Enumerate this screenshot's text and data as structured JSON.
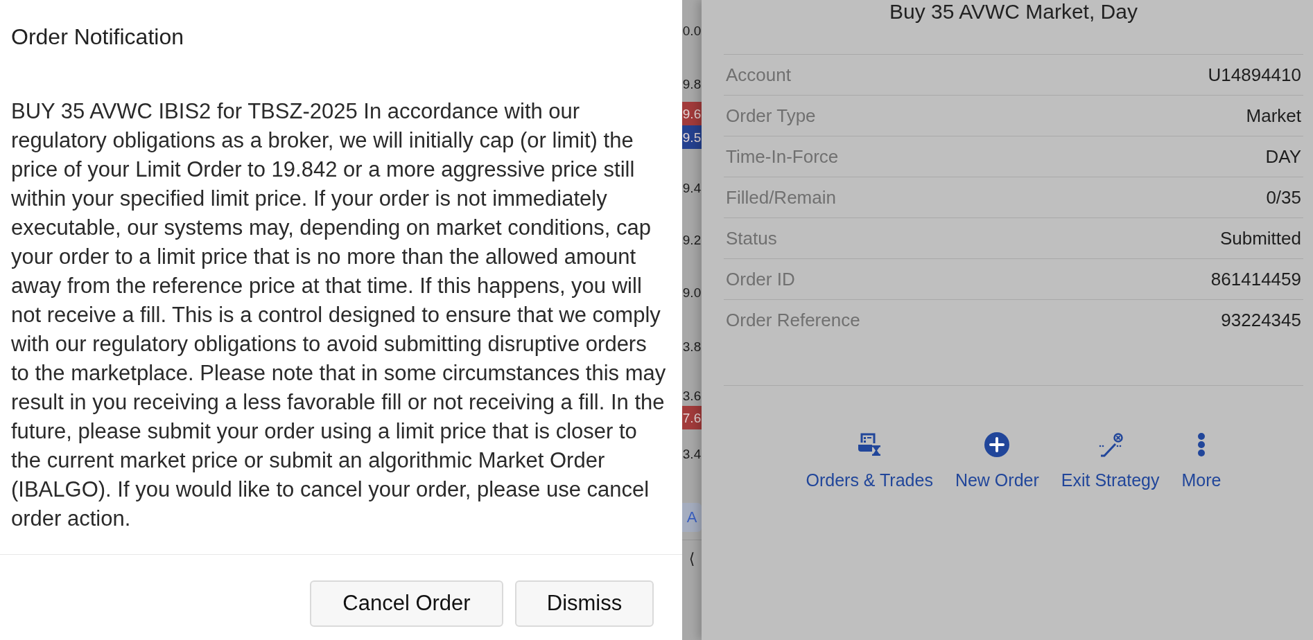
{
  "dialog": {
    "title": "Order Notification",
    "message": "BUY 35 AVWC IBIS2 for TBSZ-2025 In accordance with our regulatory obligations as a broker, we will initially cap (or limit) the price of your Limit Order to 19.842 or a more aggressive price still within your specified limit price. If your order is not immediately executable, our systems may, depending on market conditions, cap your order to a limit price that is no more than the allowed amount away from the reference price at that time. If this happens, you will not receive a fill. This is a control designed to ensure that we comply with our regulatory obligations to avoid submitting disruptive orders to the marketplace. Please note that in some circumstances this may result in you receiving a less favorable fill or not receiving a fill. In the future, please submit your order using a limit price that is closer to the current market price or submit an algorithmic Market Order (IBALGO). If you would like to cancel your order, please use cancel order action.",
    "buttons": [
      {
        "label": "Cancel Order"
      },
      {
        "label": "Dismiss"
      }
    ]
  },
  "background_ladder": [
    {
      "kind": "price",
      "text": "0.0"
    },
    {
      "kind": "price",
      "text": "9.8"
    },
    {
      "kind": "badge",
      "text": "9.6",
      "color": "#a23b3b"
    },
    {
      "kind": "badge",
      "text": "9.5",
      "color": "#25418f"
    },
    {
      "kind": "price",
      "text": "9.4"
    },
    {
      "kind": "price",
      "text": "9.2"
    },
    {
      "kind": "price",
      "text": "9.0"
    },
    {
      "kind": "price",
      "text": "3.8"
    },
    {
      "kind": "price",
      "text": "3.6"
    },
    {
      "kind": "badge",
      "text": "7.6",
      "color": "#a23b3b"
    },
    {
      "kind": "price",
      "text": "3.4"
    },
    {
      "kind": "button",
      "text": "A"
    },
    {
      "kind": "chevron",
      "text": "⟨"
    }
  ],
  "order_panel": {
    "title": "Buy 35 AVWC Market, Day",
    "fields": [
      {
        "label": "Account",
        "value": "U14894410"
      },
      {
        "label": "Order Type",
        "value": "Market"
      },
      {
        "label": "Time-In-Force",
        "value": "DAY"
      },
      {
        "label": "Filled/Remain",
        "value": "0/35"
      },
      {
        "label": "Status",
        "value": "Submitted"
      },
      {
        "label": "Order ID",
        "value": "861414459"
      },
      {
        "label": "Order Reference",
        "value": "93224345"
      }
    ],
    "actions": [
      {
        "kind": "ledger",
        "label": "Orders & Trades"
      },
      {
        "kind": "plus",
        "label": "New Order"
      },
      {
        "kind": "route",
        "label": "Exit Strategy"
      },
      {
        "kind": "dots",
        "label": "More"
      }
    ]
  }
}
